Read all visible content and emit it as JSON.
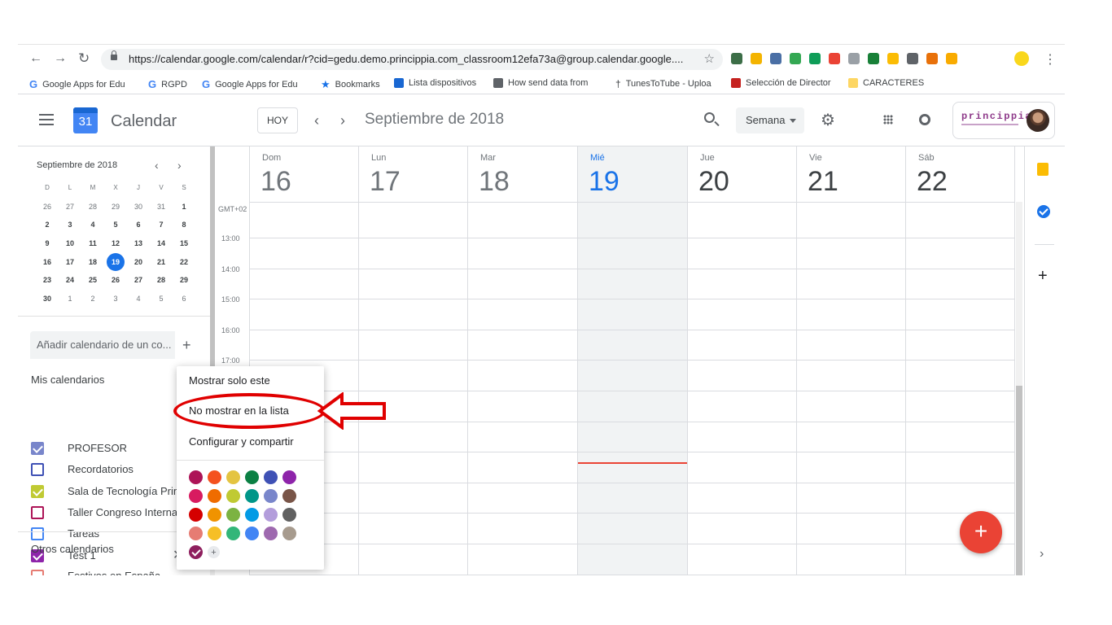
{
  "browser": {
    "url": "https://calendar.google.com/calendar/r?cid=gedu.demo.princippia.com_classroom12efa73a@group.calendar.google....",
    "extension_colors": [
      "#3c6e47",
      "#f4b400",
      "#4a6fa5",
      "#34a853",
      "#0f9d58",
      "#ea4335",
      "#9aa0a6",
      "#188038",
      "#fbbc04",
      "#5f6368",
      "#e8710a",
      "#f9ab00"
    ]
  },
  "bookmarks": [
    {
      "icon": "google-icon",
      "label": "Google Apps for Edu"
    },
    {
      "icon": "google-icon",
      "label": "RGPD"
    },
    {
      "icon": "google-icon",
      "label": "Google Apps for Edu"
    },
    {
      "icon": "star-icon",
      "label": "Bookmarks"
    },
    {
      "icon": "devices-icon",
      "label": "Lista dispositivos"
    },
    {
      "icon": "page-icon",
      "label": "How send data from"
    },
    {
      "icon": "dagger-icon",
      "label": "TunesToTube - Uploa"
    },
    {
      "icon": "red-square-icon",
      "label": "Selección de Director"
    },
    {
      "icon": "folder-icon",
      "label": "CARACTERES"
    }
  ],
  "header": {
    "app_title": "Calendar",
    "logo_day": "31",
    "today_button": "HOY",
    "month_title": "Septiembre de 2018",
    "view_select": "Semana",
    "brand": "princippia"
  },
  "mini_calendar": {
    "title": "Septiembre de 2018",
    "weekday_heads": [
      "D",
      "L",
      "M",
      "X",
      "J",
      "V",
      "S"
    ],
    "weeks": [
      [
        "26",
        "27",
        "28",
        "29",
        "30",
        "31",
        "1"
      ],
      [
        "2",
        "3",
        "4",
        "5",
        "6",
        "7",
        "8"
      ],
      [
        "9",
        "10",
        "11",
        "12",
        "13",
        "14",
        "15"
      ],
      [
        "16",
        "17",
        "18",
        "19",
        "20",
        "21",
        "22"
      ],
      [
        "23",
        "24",
        "25",
        "26",
        "27",
        "28",
        "29"
      ],
      [
        "30",
        "1",
        "2",
        "3",
        "4",
        "5",
        "6"
      ]
    ],
    "today": "19"
  },
  "sidebar": {
    "add_calendar_placeholder": "Añadir calendario de un co...",
    "my_calendars_title": "Mis calendarios",
    "my_calendars": [
      {
        "label": "PROFESOR",
        "color": "#7986cb",
        "checked": true
      },
      {
        "label": "Recordatorios",
        "color": "#3f51b5",
        "checked": false
      },
      {
        "label": "Sala de Tecnología Prin",
        "color": "#c0ca33",
        "checked": true
      },
      {
        "label": "Taller Congreso Interna",
        "color": "#ad1457",
        "checked": false
      },
      {
        "label": "Tareas",
        "color": "#4285f4",
        "checked": false
      },
      {
        "label": "Test 1",
        "color": "#8e24aa",
        "checked": true
      }
    ],
    "other_calendars_title": "Otros calendarios",
    "other_calendars": [
      {
        "label": "Festivos en España",
        "color": "#e67c73",
        "checked": false
      }
    ]
  },
  "week": {
    "days": [
      {
        "name": "Dom",
        "num": "16",
        "state": "past"
      },
      {
        "name": "Lun",
        "num": "17",
        "state": "past"
      },
      {
        "name": "Mar",
        "num": "18",
        "state": "past"
      },
      {
        "name": "Mié",
        "num": "19",
        "state": "today"
      },
      {
        "name": "Jue",
        "num": "20",
        "state": "future"
      },
      {
        "name": "Vie",
        "num": "21",
        "state": "future"
      },
      {
        "name": "Sáb",
        "num": "22",
        "state": "future"
      }
    ],
    "timezone": "GMT+02",
    "hours": [
      "13:00",
      "14:00",
      "15:00",
      "16:00",
      "17:00"
    ]
  },
  "context_menu": {
    "items": [
      "Mostrar solo este",
      "No mostrar en la lista",
      "Configurar y compartir"
    ],
    "highlighted_item": "No mostrar en la lista",
    "color_rows": [
      [
        "#ad1457",
        "#f4511e",
        "#e4c441",
        "#0b8043",
        "#3f51b5",
        "#8e24aa"
      ],
      [
        "#d81b60",
        "#ef6c00",
        "#c0ca33",
        "#009688",
        "#7986cb",
        "#795548"
      ],
      [
        "#d50000",
        "#f09300",
        "#7cb342",
        "#039be5",
        "#b39ddb",
        "#616161"
      ],
      [
        "#e67c73",
        "#f6bf26",
        "#33b679",
        "#4285f4",
        "#9e69af",
        "#a79b8e"
      ]
    ],
    "selected_color": "#8e1f5e",
    "add_color_label": "+"
  },
  "annotation_color": "#e00000"
}
